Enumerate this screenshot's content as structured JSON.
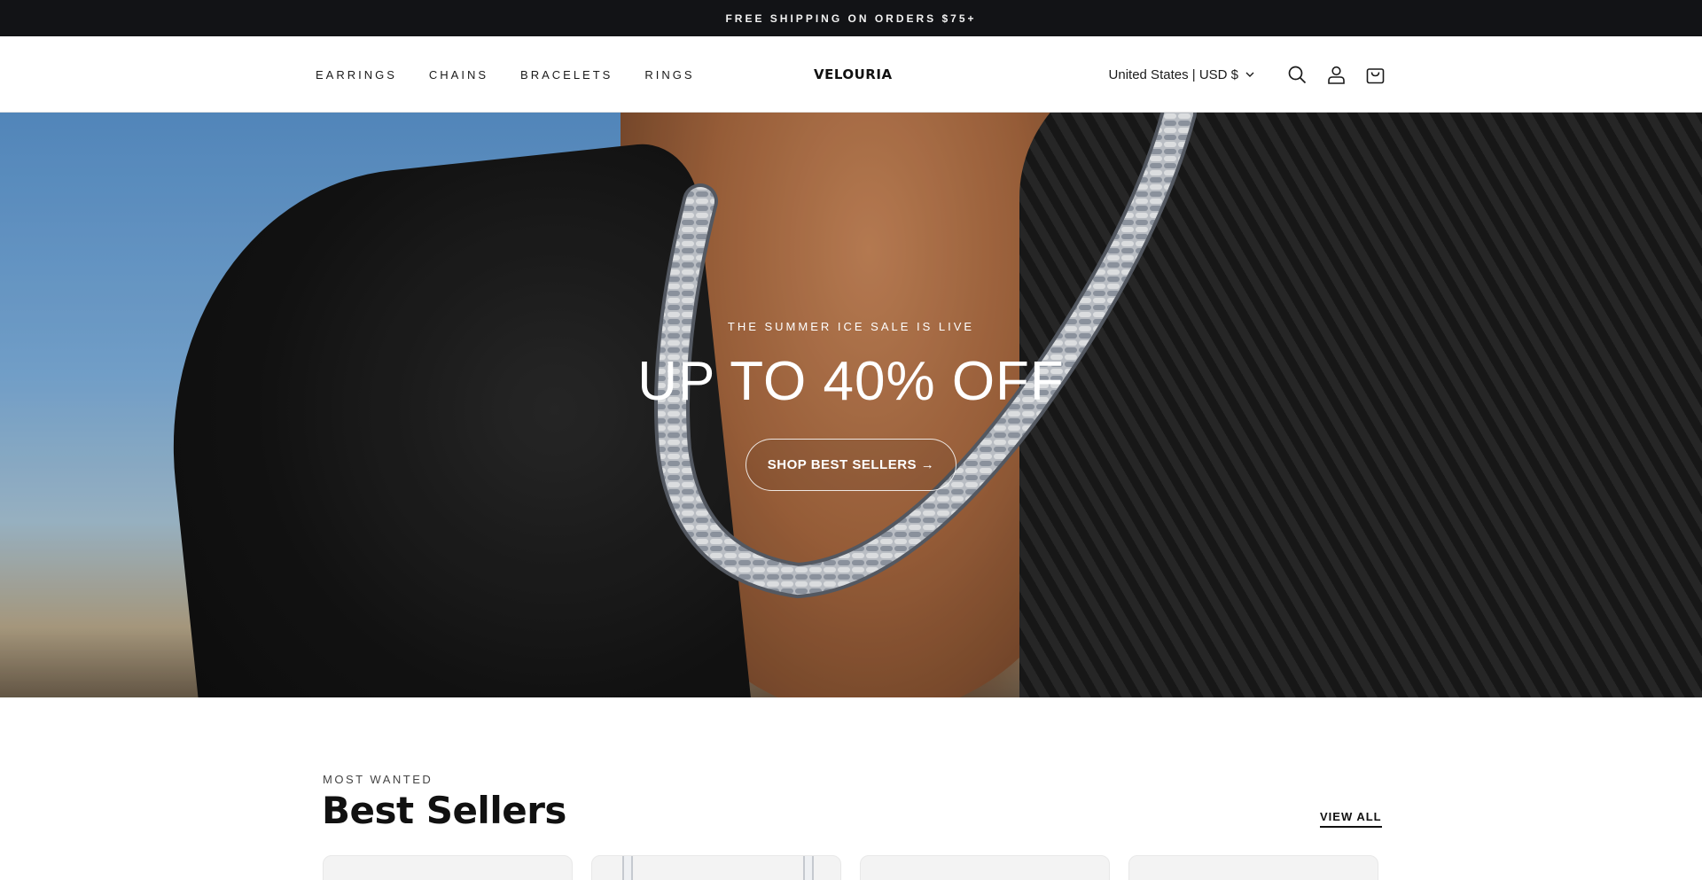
{
  "announcement": {
    "text": "FREE SHIPPING ON ORDERS $75+"
  },
  "nav": {
    "items": [
      {
        "label": "EARRINGS"
      },
      {
        "label": "CHAINS"
      },
      {
        "label": "BRACELETS"
      },
      {
        "label": "RINGS"
      }
    ]
  },
  "brand": {
    "logo_text": "VELOURIA"
  },
  "header": {
    "locale_label": "United States | USD $",
    "icons": [
      "search-icon",
      "account-icon",
      "cart-icon"
    ]
  },
  "hero": {
    "eyebrow": "THE SUMMER ICE SALE IS LIVE",
    "title": "UP TO 40% OFF",
    "cta_label": "SHOP BEST SELLERS →"
  },
  "best_sellers": {
    "eyebrow": "MOST WANTED",
    "title": "Best Sellers",
    "view_all_label": "VIEW ALL",
    "cards": [
      {
        "image": "product-image"
      },
      {
        "image": "chain-product-image"
      },
      {
        "image": "product-image"
      },
      {
        "image": "product-image"
      }
    ]
  },
  "colors": {
    "announcement_bg": "#121316",
    "text_primary": "#121212",
    "header_bg": "#ffffff"
  }
}
